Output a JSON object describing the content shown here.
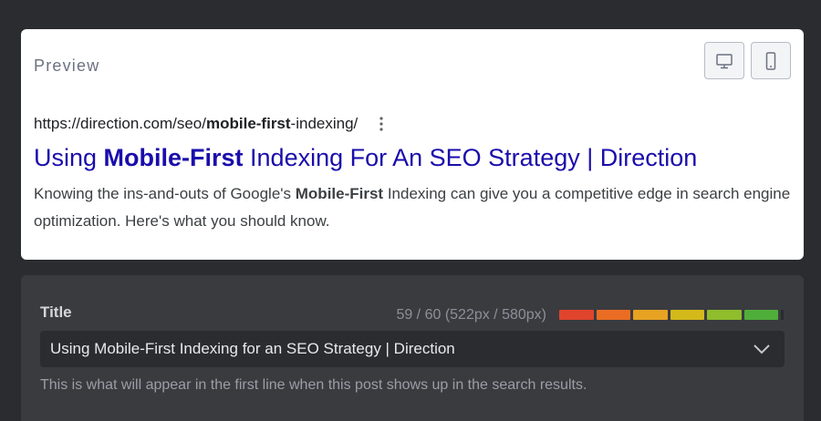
{
  "preview": {
    "heading": "Preview",
    "buttons": {
      "desktop_icon": "desktop-icon",
      "mobile_icon": "mobile-icon"
    },
    "url": {
      "prefix": "https://direction.com/seo/",
      "bold": "mobile-first",
      "suffix": "-indexing/"
    },
    "title": {
      "prefix": "Using ",
      "bold": "Mobile-First",
      "suffix": " Indexing For An SEO Strategy | Direction"
    },
    "description": {
      "prefix": "Knowing the ins-and-outs of Google's ",
      "bold": "Mobile-First",
      "suffix": " Indexing can give you a competitive edge in search engine optimization. Here's what you should know."
    }
  },
  "title_field": {
    "label": "Title",
    "counter": "59 / 60 (522px / 580px)",
    "meter": {
      "fill_fraction": 1.0,
      "segment_colors": [
        "#e0442c",
        "#ea6d23",
        "#e7a221",
        "#d4b91a",
        "#8fbd2c",
        "#4fae3a"
      ]
    },
    "value": "Using Mobile-First Indexing for an SEO Strategy | Direction",
    "help": "This is what will appear in the first line when this post shows up in the search results."
  }
}
